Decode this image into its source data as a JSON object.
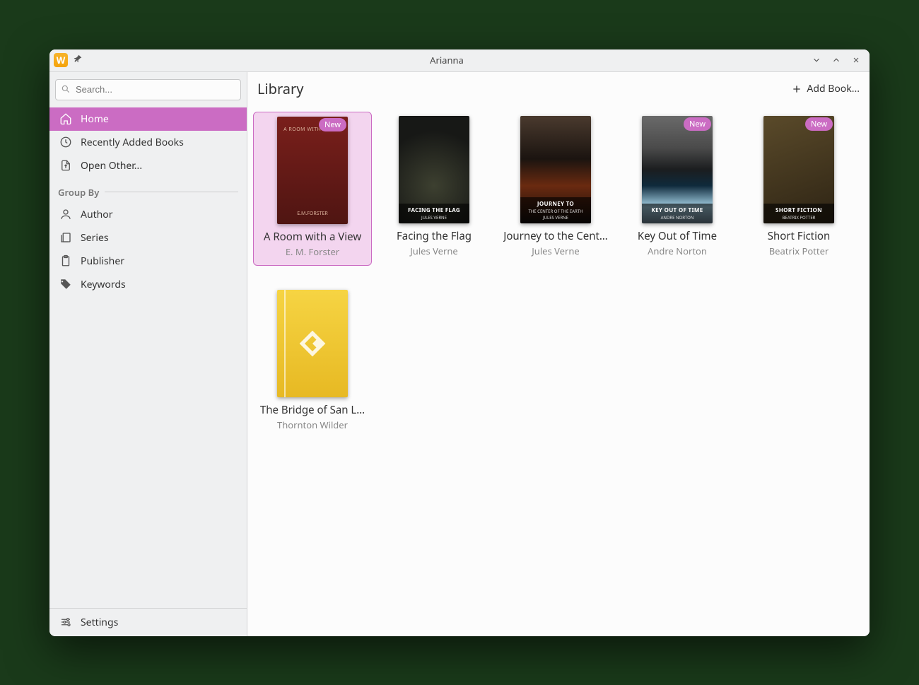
{
  "window": {
    "title": "Arianna"
  },
  "search": {
    "placeholder": "Search..."
  },
  "nav": {
    "items": [
      {
        "label": "Home"
      },
      {
        "label": "Recently Added Books"
      },
      {
        "label": "Open Other..."
      }
    ],
    "group_label": "Group By",
    "groups": [
      {
        "label": "Author"
      },
      {
        "label": "Series"
      },
      {
        "label": "Publisher"
      },
      {
        "label": "Keywords"
      }
    ],
    "settings_label": "Settings"
  },
  "main": {
    "title": "Library",
    "add_label": "Add Book...",
    "new_badge": "New"
  },
  "books": [
    {
      "title": "A Room with a View",
      "author": "E. M. Forster",
      "cover_top": "A ROOM WITH A VIEW",
      "cover_bot": "E.M.FORSTER",
      "new": true,
      "selected": true,
      "style": "red"
    },
    {
      "title": "Facing the Flag",
      "author": "Jules Verne",
      "cover_title": "FACING THE FLAG",
      "cover_sub": "JULES VERNE",
      "new": false,
      "decor": true,
      "style": "dark1"
    },
    {
      "title": "Journey to the Cent…",
      "author": "Jules Verne",
      "cover_title": "JOURNEY TO",
      "cover_sub": "THE CENTER OF THE EARTH",
      "cover_sub2": "JULES VERNE",
      "new": false,
      "decor": true,
      "style": "dark2"
    },
    {
      "title": "Key Out of Time",
      "author": "Andre Norton",
      "cover_title": "KEY OUT OF TIME",
      "cover_sub": "ANDRE NORTON",
      "new": true,
      "style": "ocean"
    },
    {
      "title": "Short Fiction",
      "author": "Beatrix Potter",
      "cover_title": "SHORT FICTION",
      "cover_sub": "BEATRIX POTTER",
      "new": true,
      "style": "rabbit"
    },
    {
      "title": "The Bridge of San L…",
      "author": "Thornton Wilder",
      "new": false,
      "style": "yellow"
    }
  ]
}
